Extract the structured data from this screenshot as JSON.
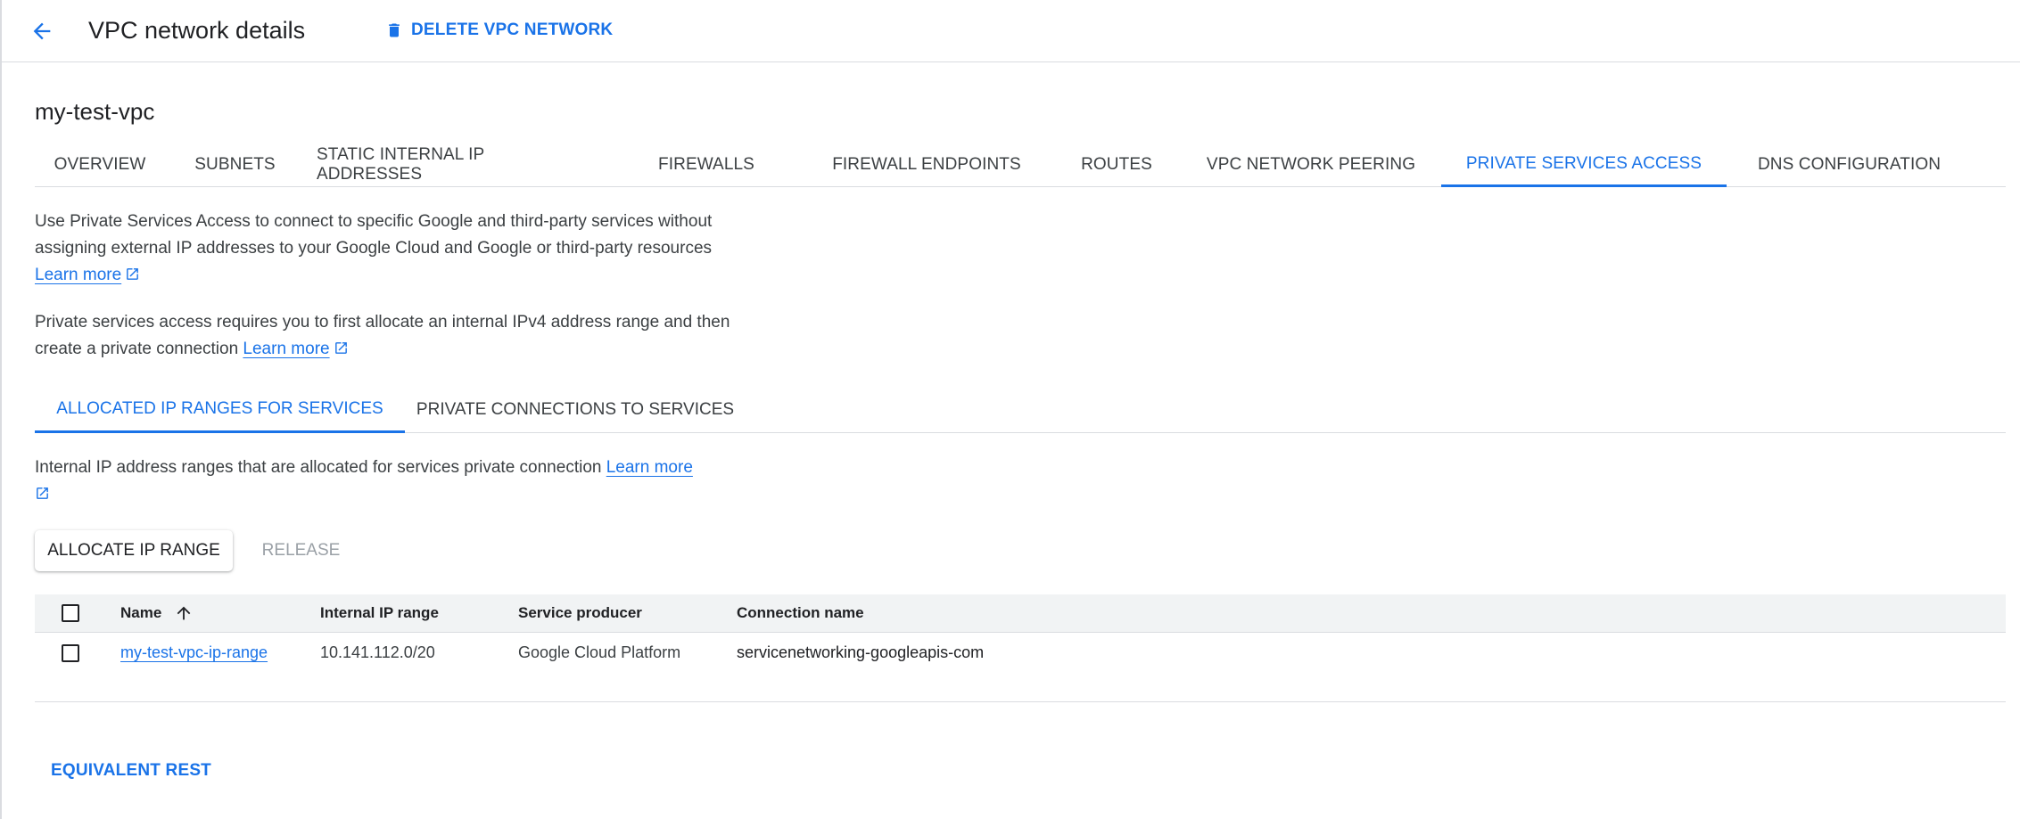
{
  "header": {
    "title": "VPC network details",
    "delete_label": "DELETE VPC NETWORK",
    "accent_color": "#1a73e8"
  },
  "network": {
    "name": "my-test-vpc"
  },
  "tabs": [
    {
      "label": "OVERVIEW",
      "active": false
    },
    {
      "label": "SUBNETS",
      "active": false
    },
    {
      "label": "STATIC INTERNAL IP ADDRESSES",
      "active": false
    },
    {
      "label": "FIREWALLS",
      "active": false
    },
    {
      "label": "FIREWALL ENDPOINTS",
      "active": false
    },
    {
      "label": "ROUTES",
      "active": false
    },
    {
      "label": "VPC NETWORK PEERING",
      "active": false
    },
    {
      "label": "PRIVATE SERVICES ACCESS",
      "active": true
    },
    {
      "label": "DNS CONFIGURATION",
      "active": false
    }
  ],
  "description": {
    "p1_text": "Use Private Services Access to connect to specific Google and third-party services without assigning external IP addresses to your Google Cloud and Google or third-party resources",
    "p1_link": "Learn more",
    "p2_text": "Private services access requires you to first allocate an internal IPv4 address range and then create a private connection",
    "p2_link": "Learn more"
  },
  "subtabs": [
    {
      "label": "ALLOCATED IP RANGES FOR SERVICES",
      "active": true
    },
    {
      "label": "PRIVATE CONNECTIONS TO SERVICES",
      "active": false
    }
  ],
  "allocated": {
    "intro_text": "Internal IP address ranges that are allocated for services private connection",
    "intro_link": "Learn more",
    "allocate_label": "ALLOCATE IP RANGE",
    "release_label": "RELEASE"
  },
  "table": {
    "columns": [
      "Name",
      "Internal IP range",
      "Service producer",
      "Connection name"
    ],
    "sort_icon": "arrow-up-icon",
    "rows": [
      {
        "name": "my-test-vpc-ip-range",
        "ip_range": "10.141.112.0/20",
        "producer": "Google Cloud Platform",
        "connection": "servicenetworking-googleapis-com"
      }
    ]
  },
  "footer": {
    "equivalent_rest": "EQUIVALENT REST"
  }
}
